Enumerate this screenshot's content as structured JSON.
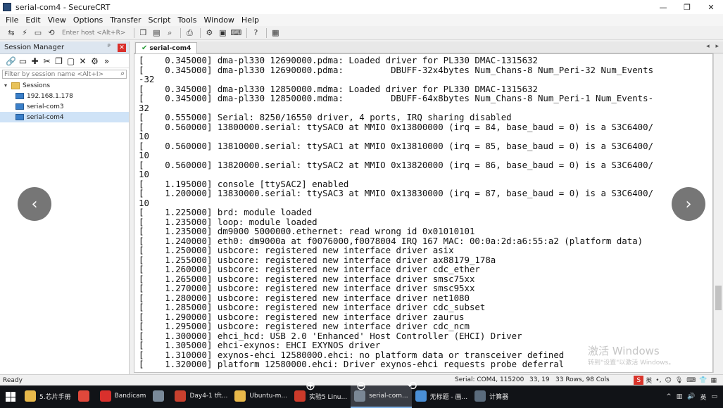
{
  "window": {
    "title": "serial-com4 - SecureCRT",
    "controls": [
      "—",
      "❐",
      "✕"
    ]
  },
  "menu": [
    "File",
    "Edit",
    "View",
    "Options",
    "Transfer",
    "Script",
    "Tools",
    "Window",
    "Help"
  ],
  "toolbar": {
    "host_placeholder": "Enter host <Alt+R>"
  },
  "session_manager": {
    "title": "Session Manager",
    "filter_placeholder": "Filter by session name <Alt+I>",
    "root": "Sessions",
    "items": [
      "192.168.1.178",
      "serial-com3",
      "serial-com4"
    ],
    "selected": "serial-com4"
  },
  "tab": {
    "label": "serial-com4"
  },
  "terminal": {
    "lines": [
      "[    0.345000] dma-pl330 12690000.pdma: Loaded driver for PL330 DMAC-1315632",
      "[    0.345000] dma-pl330 12690000.pdma:         DBUFF-32x4bytes Num_Chans-8 Num_Peri-32 Num_Events",
      "-32",
      "[    0.345000] dma-pl330 12850000.mdma: Loaded driver for PL330 DMAC-1315632",
      "[    0.345000] dma-pl330 12850000.mdma:         DBUFF-64x8bytes Num_Chans-8 Num_Peri-1 Num_Events-",
      "32",
      "[    0.555000] Serial: 8250/16550 driver, 4 ports, IRQ sharing disabled",
      "[    0.560000] 13800000.serial: ttySAC0 at MMIO 0x13800000 (irq = 84, base_baud = 0) is a S3C6400/",
      "10",
      "[    0.560000] 13810000.serial: ttySAC1 at MMIO 0x13810000 (irq = 85, base_baud = 0) is a S3C6400/",
      "10",
      "[    0.560000] 13820000.serial: ttySAC2 at MMIO 0x13820000 (irq = 86, base_baud = 0) is a S3C6400/",
      "10",
      "[    1.195000] console [ttySAC2] enabled",
      "[    1.200000] 13830000.serial: ttySAC3 at MMIO 0x13830000 (irq = 87, base_baud = 0) is a S3C6400/",
      "10",
      "[    1.225000] brd: module loaded",
      "[    1.235000] loop: module loaded",
      "[    1.235000] dm9000 5000000.ethernet: read wrong id 0x01010101",
      "[    1.240000] eth0: dm9000a at f0076000,f0078004 IRQ 167 MAC: 00:0a:2d:a6:55:a2 (platform data)",
      "[    1.250000] usbcore: registered new interface driver asix",
      "[    1.255000] usbcore: registered new interface driver ax88179_178a",
      "[    1.260000] usbcore: registered new interface driver cdc_ether",
      "[    1.265000] usbcore: registered new interface driver smsc75xx",
      "[    1.270000] usbcore: registered new interface driver smsc95xx",
      "[    1.280000] usbcore: registered new interface driver net1080",
      "[    1.285000] usbcore: registered new interface driver cdc_subset",
      "[    1.290000] usbcore: registered new interface driver zaurus",
      "[    1.295000] usbcore: registered new interface driver cdc_ncm",
      "[    1.300000] ehci_hcd: USB 2.0 'Enhanced' Host Controller (EHCI) Driver",
      "[    1.305000] ehci-exynos: EHCI EXYNOS driver",
      "[    1.310000] exynos-ehci 12580000.ehci: no platform data or transceiver defined",
      "[    1.320000] platform 12580000.ehci: Driver exynos-ehci requests probe deferral"
    ]
  },
  "watermark": {
    "title": "激活 Windows",
    "subtitle": "转到\"设置\"以激活 Windows。"
  },
  "status": {
    "ready": "Ready",
    "connection": "Serial: COM4, 115200",
    "cursor": "33, 19",
    "size": "33 Rows, 98 Cols",
    "ime_en": "英"
  },
  "taskbar": {
    "apps": [
      {
        "label": "5.芯片手册",
        "color": "#e8b84a"
      },
      {
        "label": "",
        "color": "#e0483b"
      },
      {
        "label": "Bandicam",
        "color": "#d9302c"
      },
      {
        "label": "",
        "color": "#7a8a9a"
      },
      {
        "label": "Day4-1 tft...",
        "color": "#c8402e"
      },
      {
        "label": "Ubuntu-m...",
        "color": "#e8b84a"
      },
      {
        "label": "实验5 Linu...",
        "color": "#cc3a2a"
      },
      {
        "label": "serial-com...",
        "color": "#7a8795"
      },
      {
        "label": "无标题 - 画...",
        "color": "#4a8fd6"
      },
      {
        "label": "计算器",
        "color": "#5a6b7c"
      }
    ],
    "active_index": 7,
    "tray": [
      "^",
      "英"
    ]
  }
}
